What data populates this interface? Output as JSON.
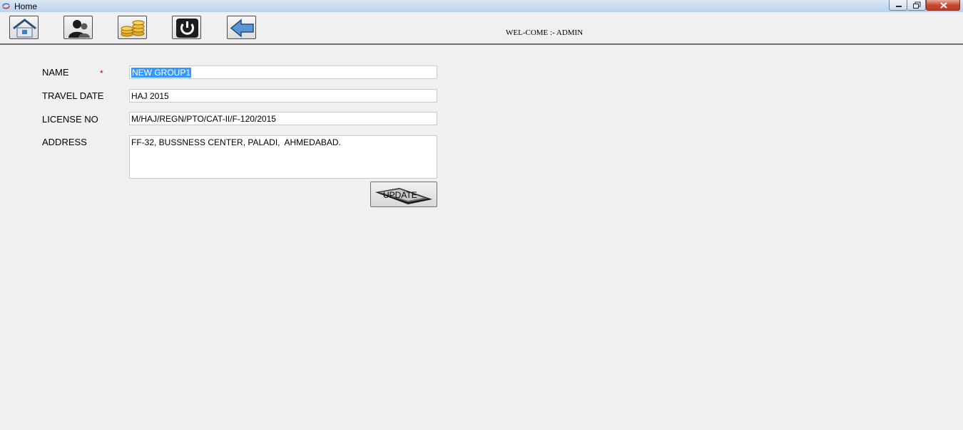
{
  "window": {
    "title": "Home"
  },
  "header": {
    "welcome_text": "WEL-COME :- ADMIN"
  },
  "toolbar": {
    "buttons": [
      {
        "icon": "home-icon"
      },
      {
        "icon": "user-icon"
      },
      {
        "icon": "coins-icon"
      },
      {
        "icon": "power-icon"
      },
      {
        "icon": "back-arrow-icon"
      }
    ]
  },
  "form": {
    "name_label": "NAME",
    "required_marker": "*",
    "name_value": "NEW GROUP1",
    "travel_date_label": "TRAVEL DATE",
    "travel_date_value": "HAJ 2015",
    "license_label": "LICENSE NO",
    "license_value": "M/HAJ/REGN/PTO/CAT-II/F-120/2015",
    "address_label": "ADDRESS",
    "address_value": "FF-32, BUSSNESS CENTER, PALADI,  AHMEDABAD.",
    "update_label": "UPDATE"
  },
  "colors": {
    "selection": "#3399ff",
    "required": "#d40000",
    "close_button": "#c23a21"
  }
}
